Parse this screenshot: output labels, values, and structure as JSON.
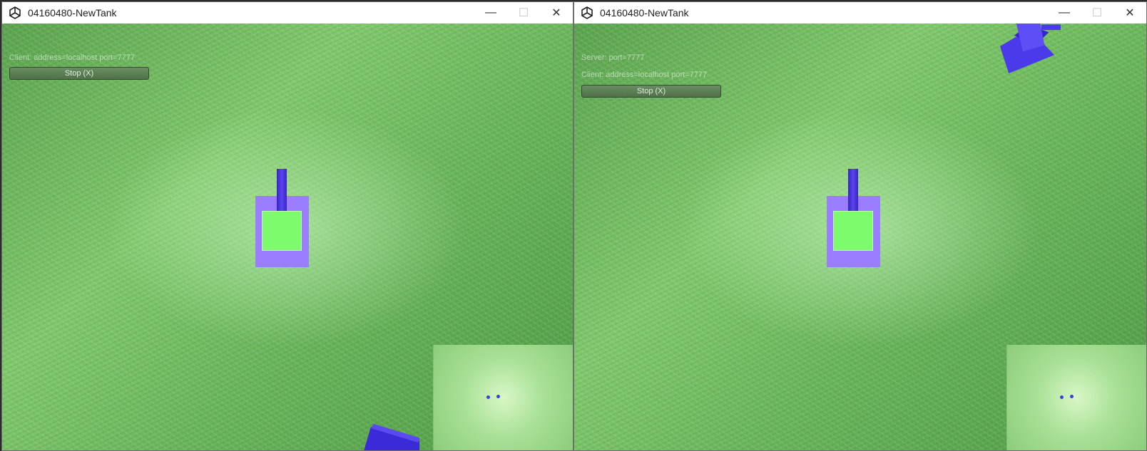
{
  "windows": [
    {
      "title": "04160480-NewTank",
      "controls": {
        "minimize": "—",
        "maximize": "☐",
        "close": "✕"
      },
      "hud": {
        "lines": [
          "Client: address=localhost port=7777"
        ],
        "stop_label": "Stop (X)"
      }
    },
    {
      "title": "04160480-NewTank",
      "controls": {
        "minimize": "—",
        "maximize": "☐",
        "close": "✕"
      },
      "hud": {
        "lines": [
          "Server: port=7777",
          "Client: address=localhost port=7777"
        ],
        "stop_label": "Stop (X)"
      }
    }
  ],
  "icons": {
    "app": "unity-icon",
    "minimize": "minimize-icon",
    "maximize": "maximize-icon",
    "close": "close-icon"
  },
  "colors": {
    "tank_hull": "#9b7dff",
    "tank_turret": "#7dfb6c",
    "tank_barrel": "#4a35e0",
    "grass": "#6bb85c",
    "stop_button": "#5b7a55"
  }
}
